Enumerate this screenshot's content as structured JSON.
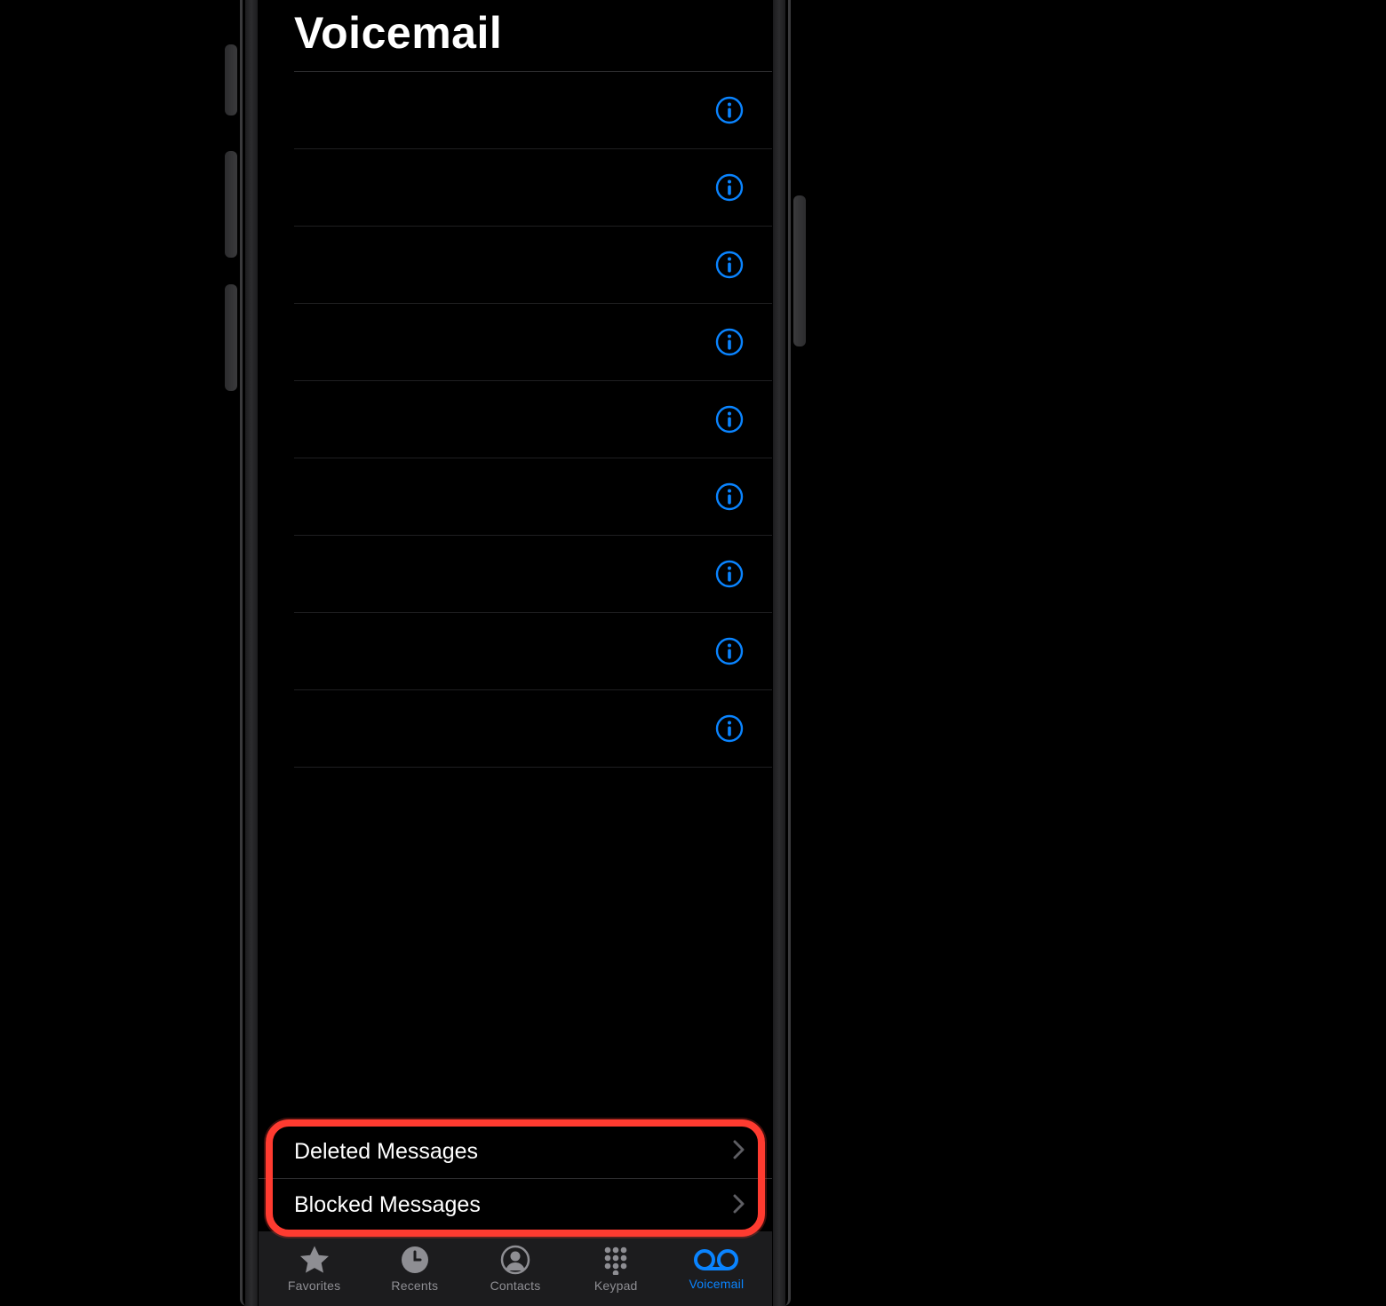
{
  "header": {
    "title": "Voicemail"
  },
  "voicemail_rows": [
    {},
    {},
    {},
    {},
    {},
    {},
    {},
    {},
    {}
  ],
  "folders": {
    "deleted": "Deleted Messages",
    "blocked": "Blocked Messages"
  },
  "tabs": {
    "favorites": "Favorites",
    "recents": "Recents",
    "contacts": "Contacts",
    "keypad": "Keypad",
    "voicemail": "Voicemail"
  },
  "colors": {
    "accent": "#0a84ff",
    "highlight": "#ff3b30",
    "inactive": "#8e8e93"
  }
}
